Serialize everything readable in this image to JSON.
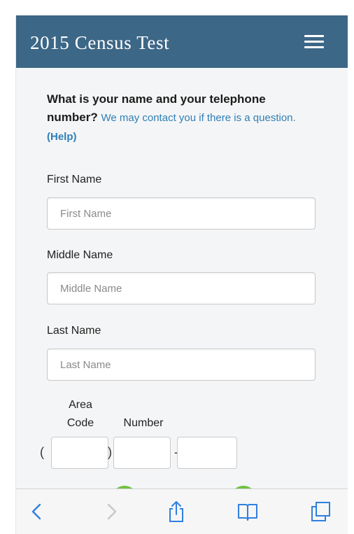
{
  "header": {
    "title": "2015 Census Test",
    "menu_icon": "hamburger-menu-icon",
    "background_color": "#3d6786"
  },
  "question": {
    "bold_text": "What is your name and your telephone number?",
    "note_text": "We may contact you if there is a question.",
    "help_link": "(Help)",
    "link_color": "#2f7fb7"
  },
  "form": {
    "first_name": {
      "label": "First Name",
      "placeholder": "First Name",
      "value": ""
    },
    "middle_name": {
      "label": "Middle Name",
      "placeholder": "Middle Name",
      "value": ""
    },
    "last_name": {
      "label": "Last Name",
      "placeholder": "Last Name",
      "value": ""
    },
    "phone": {
      "area_code_label_line1": "Area",
      "area_code_label_line2": "Code",
      "number_label": "Number",
      "open_paren": "(",
      "close_paren": ")",
      "dash": "-"
    }
  },
  "browser_toolbar": {
    "back_icon": "chevron-left-icon",
    "forward_icon": "chevron-right-icon",
    "share_icon": "share-icon",
    "bookmarks_icon": "book-icon",
    "tabs_icon": "tabs-icon",
    "icon_color": "#2f7fe0"
  }
}
